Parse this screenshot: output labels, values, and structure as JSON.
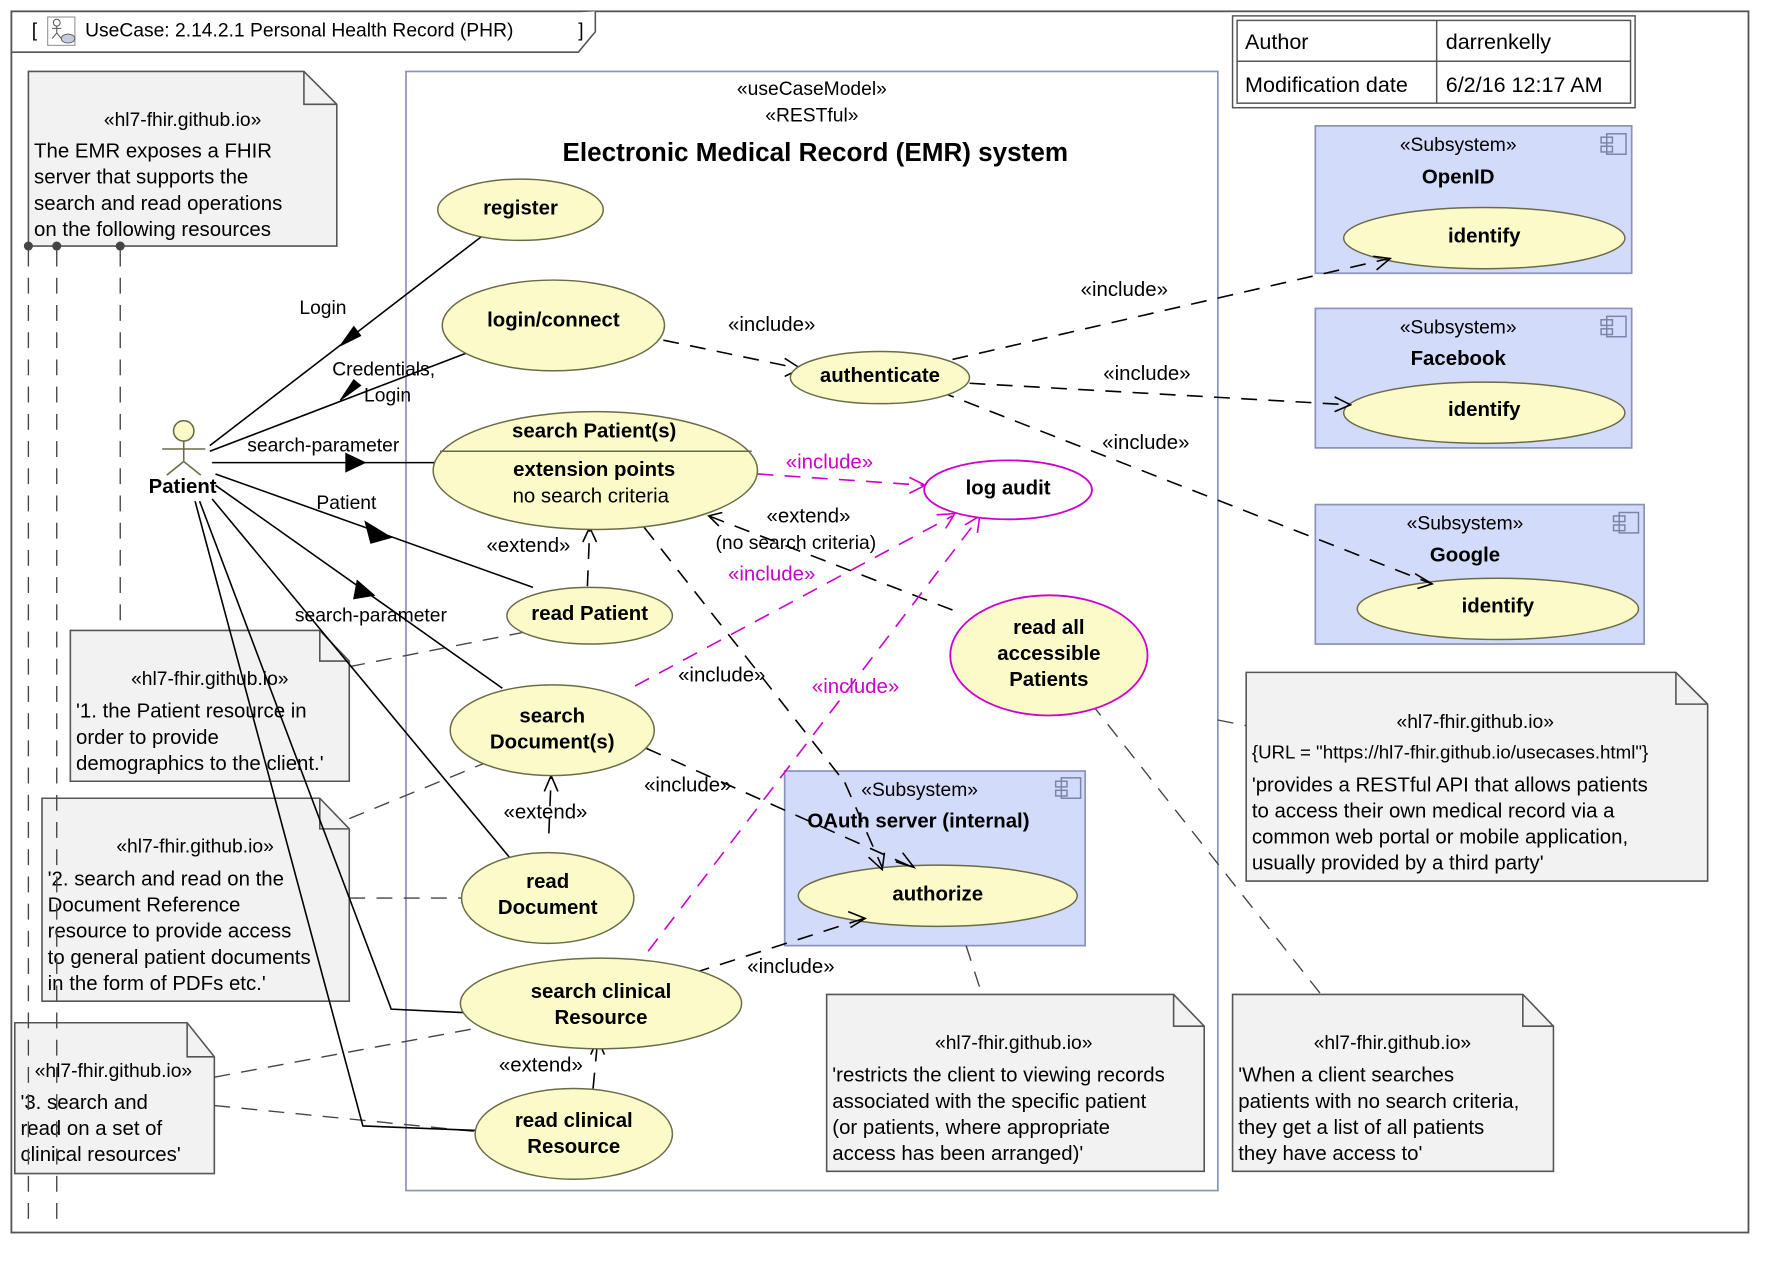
{
  "diagram": {
    "frame_title": "UseCase: 2.14.2.1 Personal Health Record (PHR)",
    "frame_title_prefix": "[",
    "frame_title_suffix": "]",
    "frame_icon": "usecase-diagram-icon"
  },
  "info_table": {
    "rows": [
      {
        "key": "Author",
        "value": "darrenkelly"
      },
      {
        "key": "Modification date",
        "value": "6/2/16 12:17 AM"
      }
    ]
  },
  "system": {
    "stereotype1": "«useCaseModel»",
    "stereotype2": "«RESTful»",
    "name": "Electronic Medical Record (EMR) system"
  },
  "actor": {
    "name": "Patient",
    "icon": "stick-figure-icon"
  },
  "use_cases": {
    "register": "register",
    "login": "login/connect",
    "authenticate": "authenticate",
    "search_patient": {
      "name": "search Patient(s)",
      "ext_title": "extension points",
      "ext_point": "no search criteria"
    },
    "log_audit": "log audit",
    "read_patient": "read Patient",
    "read_all": [
      "read all",
      "accessible",
      "Patients"
    ],
    "search_doc": [
      "search",
      "Document(s)"
    ],
    "read_doc": [
      "read",
      "Document"
    ],
    "search_clin": [
      "search clinical",
      "Resource"
    ],
    "read_clin": [
      "read clinical",
      "Resource"
    ]
  },
  "subsystems": [
    {
      "stereotype": "«Subsystem»",
      "name": "OpenID",
      "use_case": "identify",
      "icon": "component-icon"
    },
    {
      "stereotype": "«Subsystem»",
      "name": "Facebook",
      "use_case": "identify",
      "icon": "component-icon"
    },
    {
      "stereotype": "«Subsystem»",
      "name": "Google",
      "use_case": "identify",
      "icon": "component-icon"
    },
    {
      "stereotype": "«Subsystem»",
      "name": "OAuth server (internal)",
      "use_case": "authorize",
      "icon": "component-icon"
    }
  ],
  "edge_labels": {
    "login": "Login",
    "credentials1": "Credentials,",
    "credentials2": "Login",
    "search_param1": "search-parameter",
    "patient": "Patient",
    "search_param2": "search-parameter",
    "include": "«include»",
    "extend": "«extend»",
    "extend_cond": "(no search criteria)"
  },
  "notes": {
    "stereotype": "«hl7-fhir.github.io»",
    "top_left": [
      "The EMR exposes a FHIR",
      "server that supports the",
      "search and read operations",
      "on the following resources"
    ],
    "n1": [
      "'1. the Patient resource in",
      "order to provide",
      "demographics to the client.'"
    ],
    "n2": [
      "'2. search and read on the",
      "Document Reference",
      "resource to provide access",
      "to general patient documents",
      "in the form of PDFs etc.'"
    ],
    "n3": [
      "'3. search and",
      "read on a set of",
      "clinical resources'"
    ],
    "oauth": [
      "'restricts the client to viewing records",
      "associated with the specific patient",
      "(or patients, where appropriate",
      "access has been arranged)'"
    ],
    "readall": [
      "'When a client searches",
      "patients with no search criteria,",
      "they get a list of all patients",
      "they have access to'"
    ],
    "api_url": "{URL = \"https://hl7-fhir.github.io/usecases.html\"}",
    "api": [
      "'provides a RESTful API that allows patients",
      "to access their own medical record via a",
      "common web portal or mobile application,",
      "usually provided by a third party'"
    ]
  },
  "colors": {
    "use_case_fill": "#fbfbca",
    "subsystem_fill": "#d3dbfb",
    "note_fill": "#f2f2f2",
    "audit_include": "#cc00cc"
  }
}
